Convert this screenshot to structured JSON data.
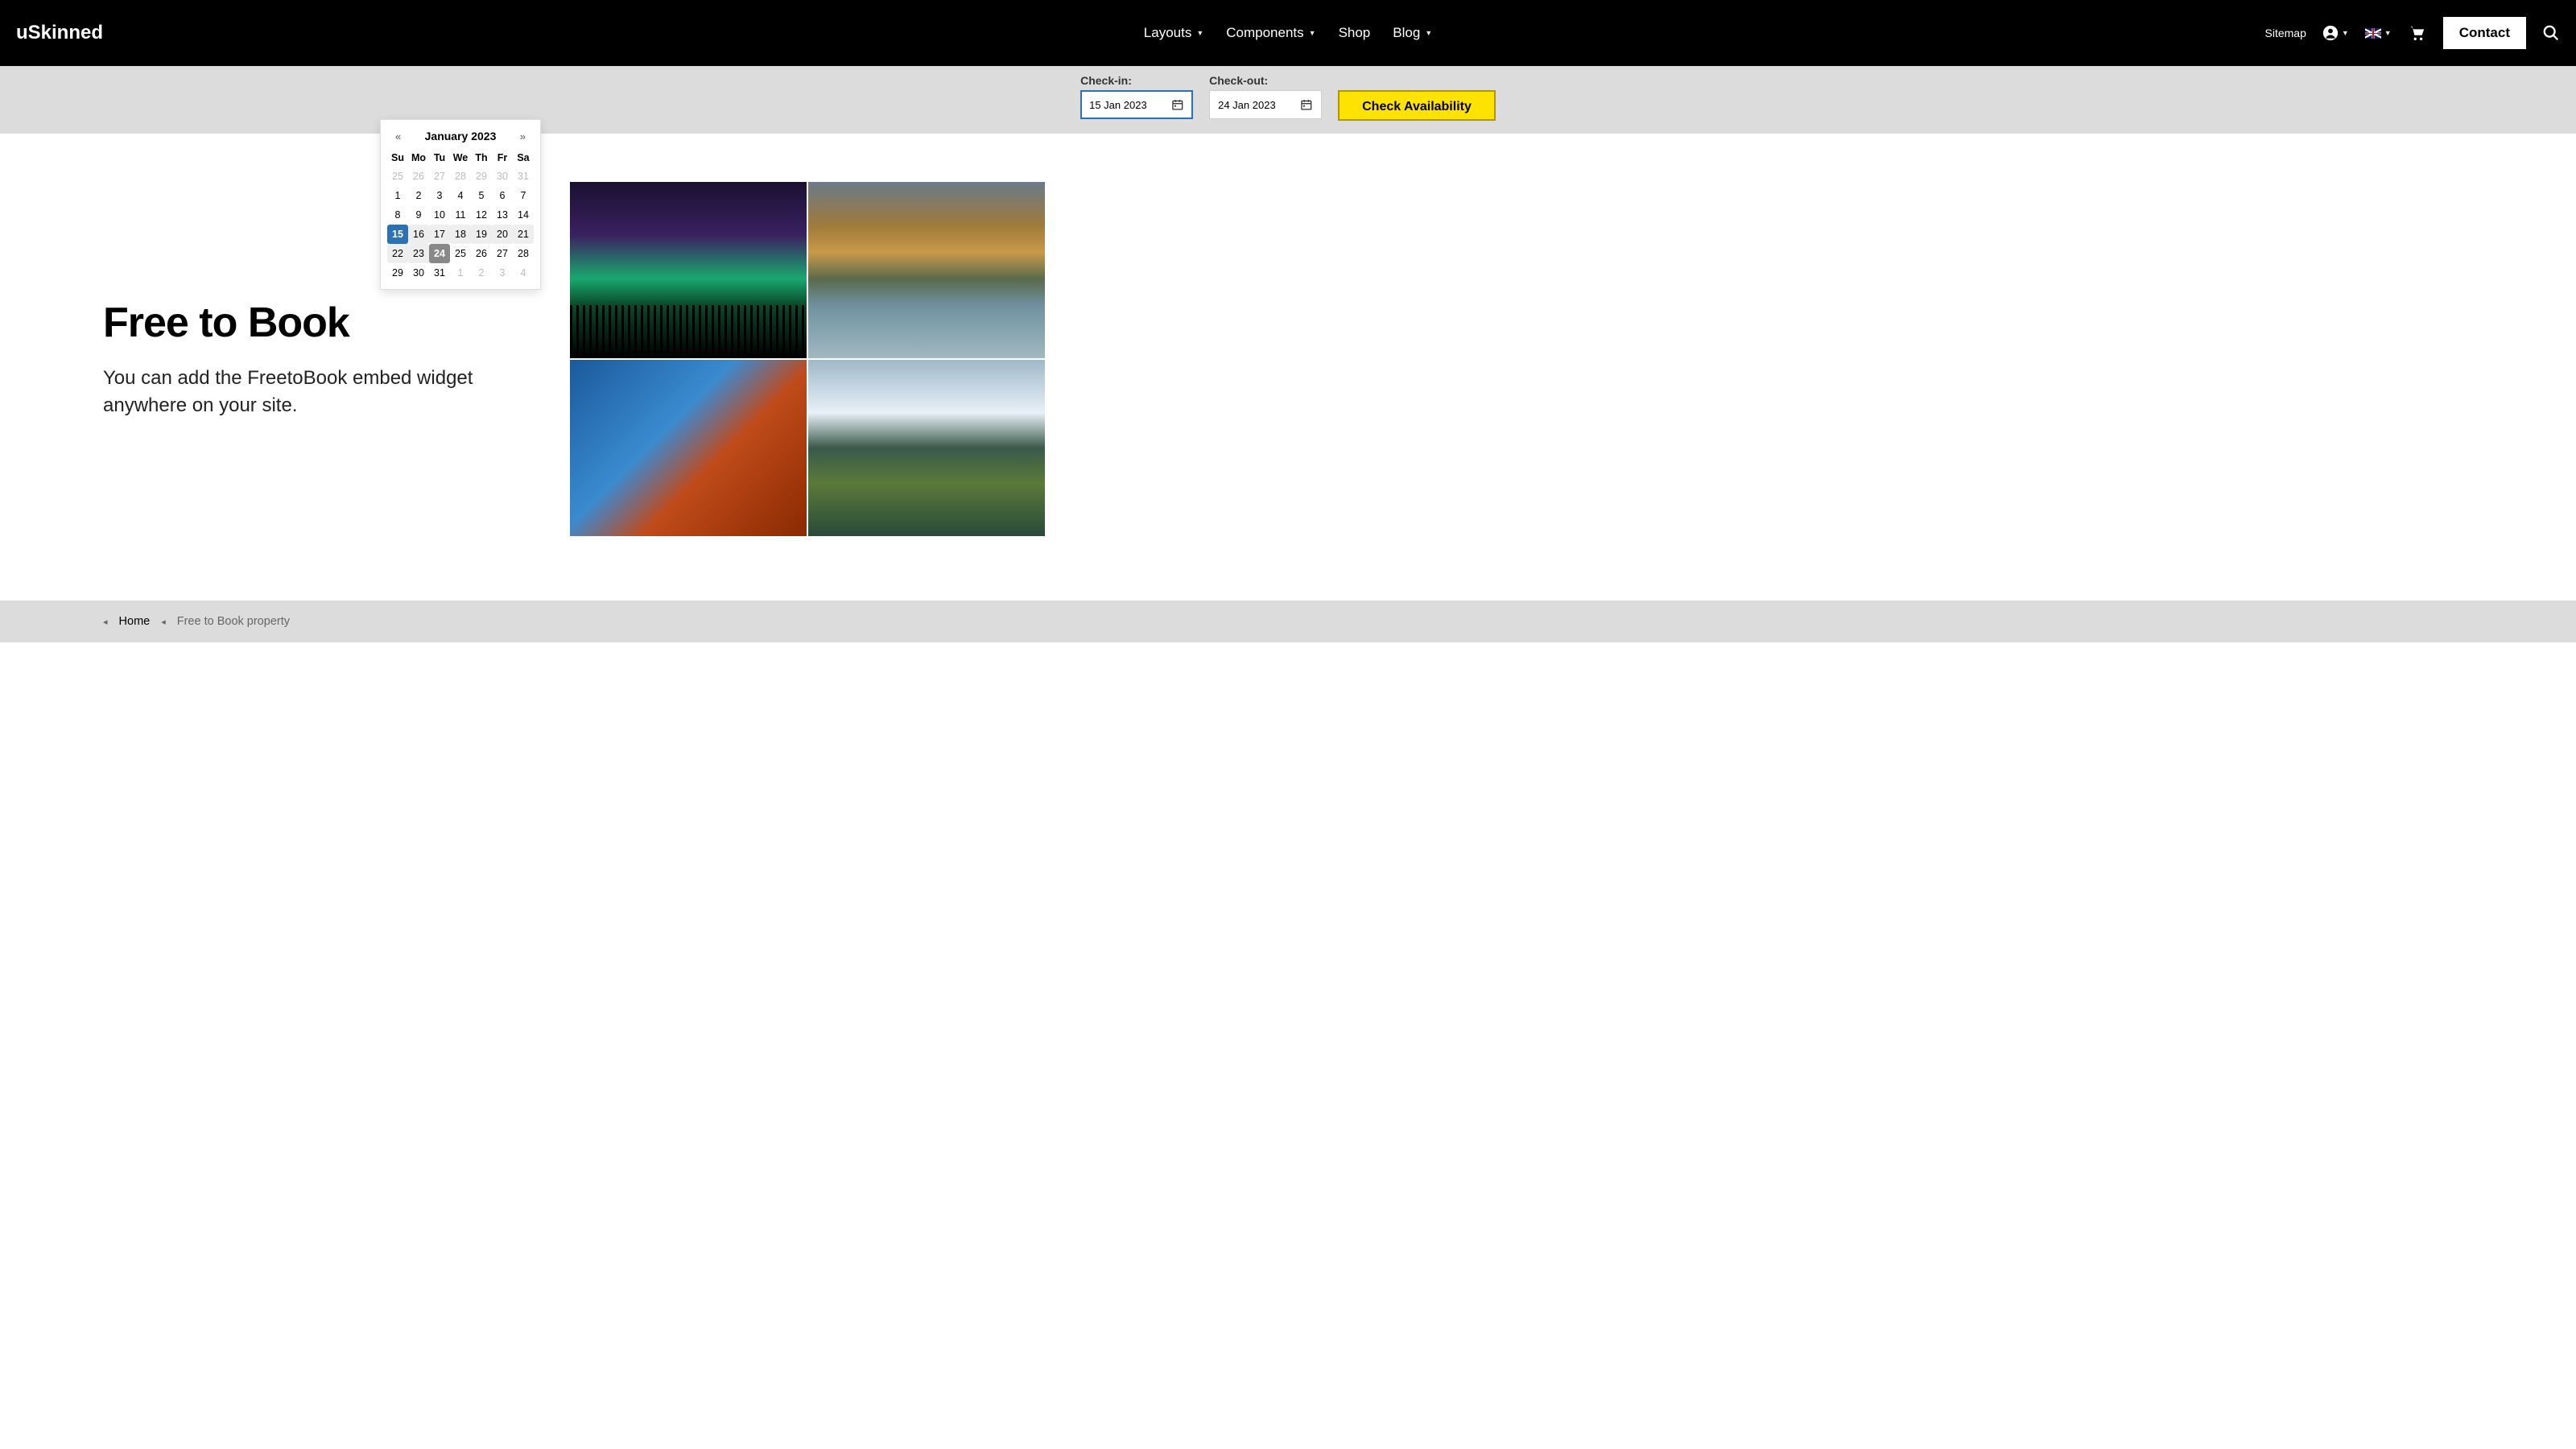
{
  "header": {
    "logo": "uSkinned",
    "nav": [
      {
        "label": "Layouts",
        "dropdown": true
      },
      {
        "label": "Components",
        "dropdown": true
      },
      {
        "label": "Shop",
        "dropdown": false
      },
      {
        "label": "Blog",
        "dropdown": true
      }
    ],
    "sitemap": "Sitemap",
    "contact": "Contact"
  },
  "booking": {
    "checkin_label": "Check-in:",
    "checkout_label": "Check-out:",
    "checkin_value": "15 Jan 2023",
    "checkout_value": "24 Jan 2023",
    "button": "Check Availability"
  },
  "datepicker": {
    "prev": "«",
    "next": "»",
    "month": "January 2023",
    "dow": [
      "Su",
      "Mo",
      "Tu",
      "We",
      "Th",
      "Fr",
      "Sa"
    ],
    "weeks": [
      [
        {
          "d": "25",
          "m": true
        },
        {
          "d": "26",
          "m": true
        },
        {
          "d": "27",
          "m": true
        },
        {
          "d": "28",
          "m": true
        },
        {
          "d": "29",
          "m": true
        },
        {
          "d": "30",
          "m": true
        },
        {
          "d": "31",
          "m": true
        }
      ],
      [
        {
          "d": "1"
        },
        {
          "d": "2"
        },
        {
          "d": "3"
        },
        {
          "d": "4"
        },
        {
          "d": "5"
        },
        {
          "d": "6"
        },
        {
          "d": "7"
        }
      ],
      [
        {
          "d": "8"
        },
        {
          "d": "9"
        },
        {
          "d": "10"
        },
        {
          "d": "11"
        },
        {
          "d": "12"
        },
        {
          "d": "13"
        },
        {
          "d": "14"
        }
      ],
      [
        {
          "d": "15",
          "sel": true
        },
        {
          "d": "16",
          "r": true
        },
        {
          "d": "17",
          "r": true
        },
        {
          "d": "18",
          "r": true
        },
        {
          "d": "19",
          "r": true
        },
        {
          "d": "20",
          "r": true
        },
        {
          "d": "21",
          "r": true
        }
      ],
      [
        {
          "d": "22",
          "r": true
        },
        {
          "d": "23",
          "r": true
        },
        {
          "d": "24",
          "end": true
        },
        {
          "d": "25"
        },
        {
          "d": "26"
        },
        {
          "d": "27"
        },
        {
          "d": "28"
        }
      ],
      [
        {
          "d": "29"
        },
        {
          "d": "30"
        },
        {
          "d": "31"
        },
        {
          "d": "1",
          "m": true
        },
        {
          "d": "2",
          "m": true
        },
        {
          "d": "3",
          "m": true
        },
        {
          "d": "4",
          "m": true
        }
      ]
    ]
  },
  "main": {
    "title": "Free to Book",
    "subtitle": "You can add the FreetoBook embed widget anywhere on your site."
  },
  "breadcrumb": {
    "home": "Home",
    "current": "Free to Book property"
  }
}
